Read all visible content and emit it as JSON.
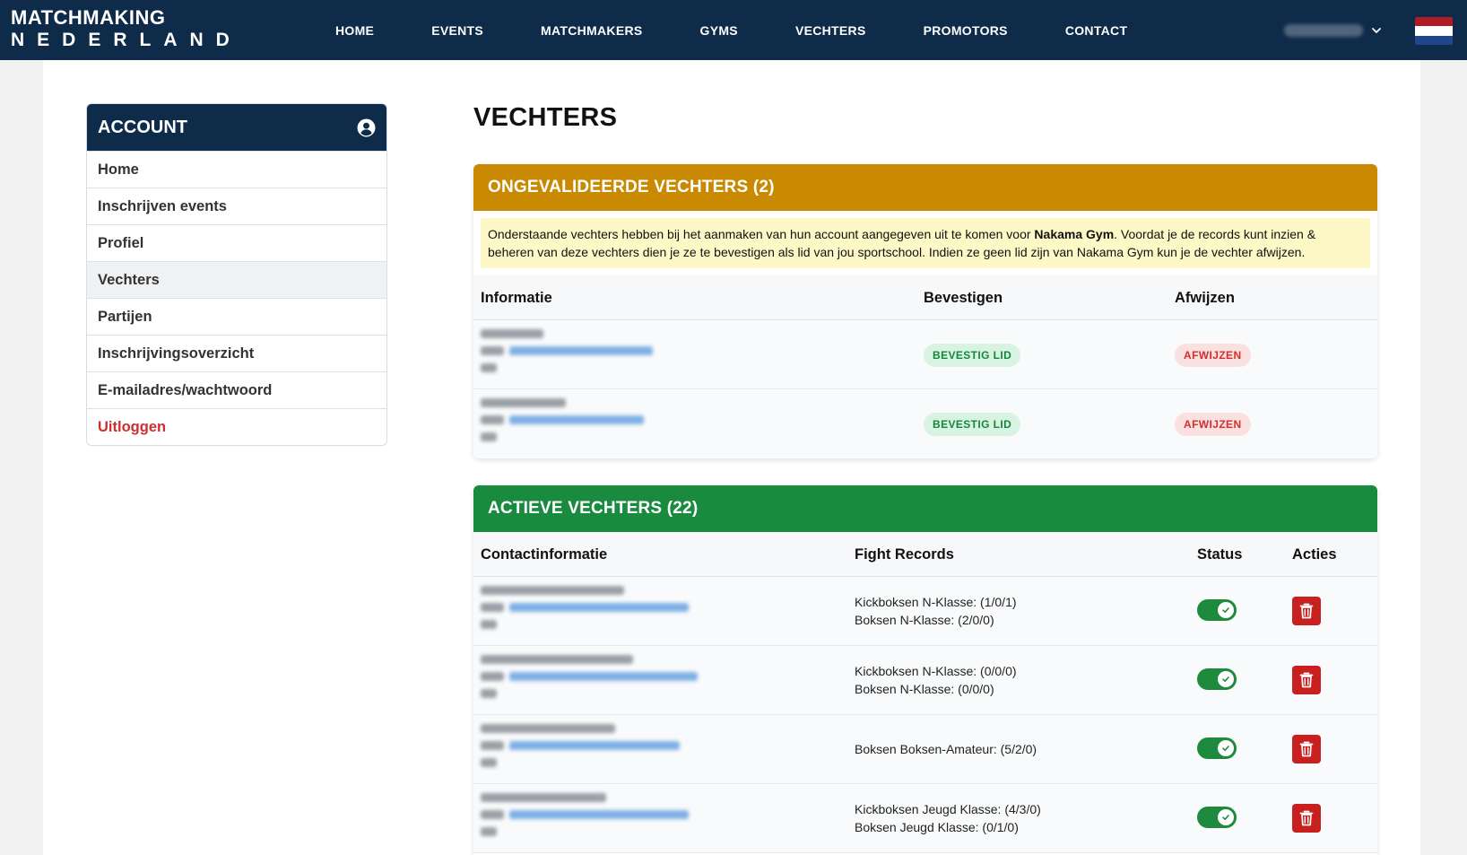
{
  "brand": {
    "line1": "MATCHMAKING",
    "line2": "NEDERLAND"
  },
  "nav": [
    "HOME",
    "EVENTS",
    "MATCHMAKERS",
    "GYMS",
    "VECHTERS",
    "PROMOTORS",
    "CONTACT"
  ],
  "flag_colors": [
    "#ae1c28",
    "#ffffff",
    "#21468b"
  ],
  "sidebar": {
    "title": "ACCOUNT",
    "items": [
      "Home",
      "Inschrijven events",
      "Profiel",
      "Vechters",
      "Partijen",
      "Inschrijvingsoverzicht",
      "E-mailadres/wachtwoord",
      "Uitloggen"
    ],
    "active_item": "Vechters"
  },
  "page": {
    "title": "VECHTERS"
  },
  "unvalidated": {
    "header": "ONGEVALIDEERDE VECHTERS (2)",
    "header_color": "#c98a02",
    "notice_pre": "Onderstaande vechters hebben bij het aanmaken van hun account aangegeven uit te komen voor ",
    "notice_gym": "Nakama Gym",
    "notice_post": ". Voordat je de records kunt inzien & beheren van deze vechters dien je ze te bevestigen als lid van jou sportschool. Indien ze geen lid zijn van Nakama Gym kun je de vechter afwijzen.",
    "columns": [
      "Informatie",
      "Bevestigen",
      "Afwijzen"
    ],
    "confirm_label": "BEVESTIG LID",
    "reject_label": "AFWIJZEN"
  },
  "active": {
    "header": "ACTIEVE VECHTERS (22)",
    "header_color": "#1a8a3f",
    "columns": [
      "Contactinformatie",
      "Fight Records",
      "Status",
      "Acties"
    ],
    "rows": [
      {
        "records": [
          "Kickboksen N-Klasse: (1/0/1)",
          "Boksen N-Klasse: (2/0/0)"
        ],
        "status_on": true
      },
      {
        "records": [
          "Kickboksen N-Klasse: (0/0/0)",
          "Boksen N-Klasse: (0/0/0)"
        ],
        "status_on": true
      },
      {
        "records": [
          "Boksen Boksen-Amateur: (5/2/0)"
        ],
        "status_on": true
      },
      {
        "records": [
          "Kickboksen Jeugd Klasse: (4/3/0)",
          "Boksen Jeugd Klasse: (0/1/0)"
        ],
        "status_on": true
      }
    ]
  }
}
